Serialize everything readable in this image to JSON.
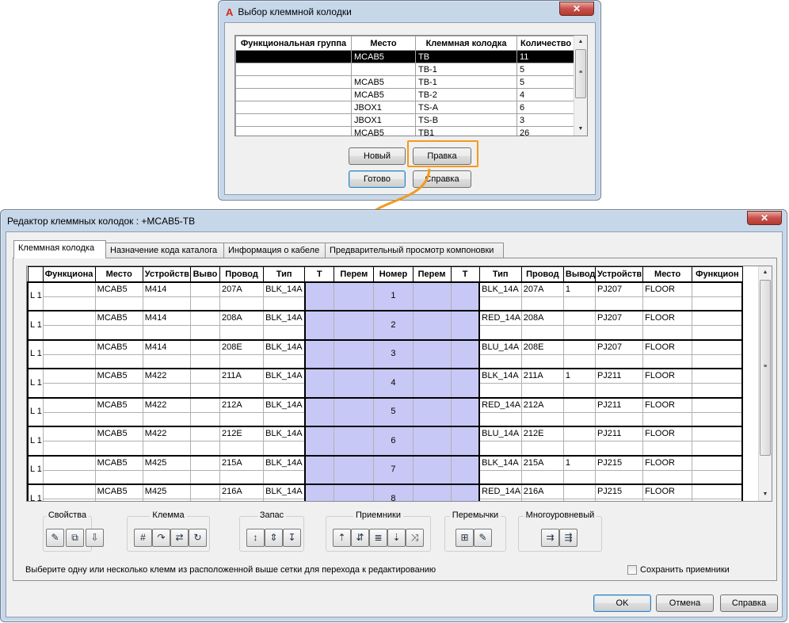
{
  "select_dialog": {
    "title": "Выбор клеммной колодки",
    "columns": [
      "Функциональная группа",
      "Место",
      "Клеммная колодка",
      "Количество"
    ],
    "rows": [
      [
        "",
        "MCAB5",
        "TB",
        "11"
      ],
      [
        "",
        "",
        "TB-1",
        "5"
      ],
      [
        "",
        "MCAB5",
        "TB-1",
        "5"
      ],
      [
        "",
        "MCAB5",
        "TB-2",
        "4"
      ],
      [
        "",
        "JBOX1",
        "TS-A",
        "6"
      ],
      [
        "",
        "JBOX1",
        "TS-B",
        "3"
      ],
      [
        "",
        "MCAB5",
        "TB1",
        "26"
      ]
    ],
    "buttons": {
      "new": "Новый",
      "edit": "Правка",
      "done": "Готово",
      "help": "Справка"
    }
  },
  "editor": {
    "title": "Редактор клеммных колодок : +MCAB5-TB",
    "tabs": [
      "Клеммная колодка",
      "Назначение кода каталога",
      "Информация о кабеле",
      "Предварительный просмотр компоновки"
    ],
    "columns": [
      "",
      "Функциона",
      "Место",
      "Устройств",
      "Выво",
      "Провод",
      "Тип",
      "T",
      "Перем",
      "Номер",
      "Перем",
      "T",
      "Тип",
      "Провод",
      "Вывод",
      "Устройств",
      "Место",
      "Функцион"
    ],
    "rows": [
      {
        "label": "L 1",
        "loc": "MCAB5",
        "dev": "M414",
        "wire": "207A",
        "type": "BLK_14A",
        "num": "1",
        "rtype": "BLK_14A",
        "rwire": "207A",
        "rpin": "1",
        "rdev": "PJ207",
        "rloc": "FLOOR"
      },
      {
        "label": "L 1",
        "loc": "MCAB5",
        "dev": "M414",
        "wire": "208A",
        "type": "BLK_14A",
        "num": "2",
        "rtype": "RED_14A",
        "rwire": "208A",
        "rpin": "",
        "rdev": "PJ207",
        "rloc": "FLOOR"
      },
      {
        "label": "L 1",
        "loc": "MCAB5",
        "dev": "M414",
        "wire": "208E",
        "type": "BLK_14A",
        "num": "3",
        "rtype": "BLU_14A",
        "rwire": "208E",
        "rpin": "",
        "rdev": "PJ207",
        "rloc": "FLOOR"
      },
      {
        "label": "L 1",
        "loc": "MCAB5",
        "dev": "M422",
        "wire": "211A",
        "type": "BLK_14A",
        "num": "4",
        "rtype": "BLK_14A",
        "rwire": "211A",
        "rpin": "1",
        "rdev": "PJ211",
        "rloc": "FLOOR"
      },
      {
        "label": "L 1",
        "loc": "MCAB5",
        "dev": "M422",
        "wire": "212A",
        "type": "BLK_14A",
        "num": "5",
        "rtype": "RED_14A",
        "rwire": "212A",
        "rpin": "",
        "rdev": "PJ211",
        "rloc": "FLOOR"
      },
      {
        "label": "L 1",
        "loc": "MCAB5",
        "dev": "M422",
        "wire": "212E",
        "type": "BLK_14A",
        "num": "6",
        "rtype": "BLU_14A",
        "rwire": "212E",
        "rpin": "",
        "rdev": "PJ211",
        "rloc": "FLOOR"
      },
      {
        "label": "L 1",
        "loc": "MCAB5",
        "dev": "M425",
        "wire": "215A",
        "type": "BLK_14A",
        "num": "7",
        "rtype": "BLK_14A",
        "rwire": "215A",
        "rpin": "1",
        "rdev": "PJ215",
        "rloc": "FLOOR"
      },
      {
        "label": "L 1",
        "loc": "MCAB5",
        "dev": "M425",
        "wire": "216A",
        "type": "BLK_14A",
        "num": "8",
        "rtype": "RED_14A",
        "rwire": "216A",
        "rpin": "",
        "rdev": "PJ215",
        "rloc": "FLOOR"
      }
    ],
    "groups": {
      "props": "Свойства",
      "terminal": "Клемма",
      "spare": "Запас",
      "receivers": "Приемники",
      "jumpers": "Перемычки",
      "multilevel": "Многоуровневый"
    },
    "status_text": "Выберите одну или несколько клемм из расположенной выше сетки для перехода к редактированию",
    "save_receivers": "Сохранить приемники",
    "buttons": {
      "ok": "OK",
      "cancel": "Отмена",
      "help": "Справка"
    }
  },
  "colors": {
    "accent_callout": "#f39a1e",
    "terminal_blue": "#c8c8f7",
    "title_icon": "#d9261c"
  }
}
